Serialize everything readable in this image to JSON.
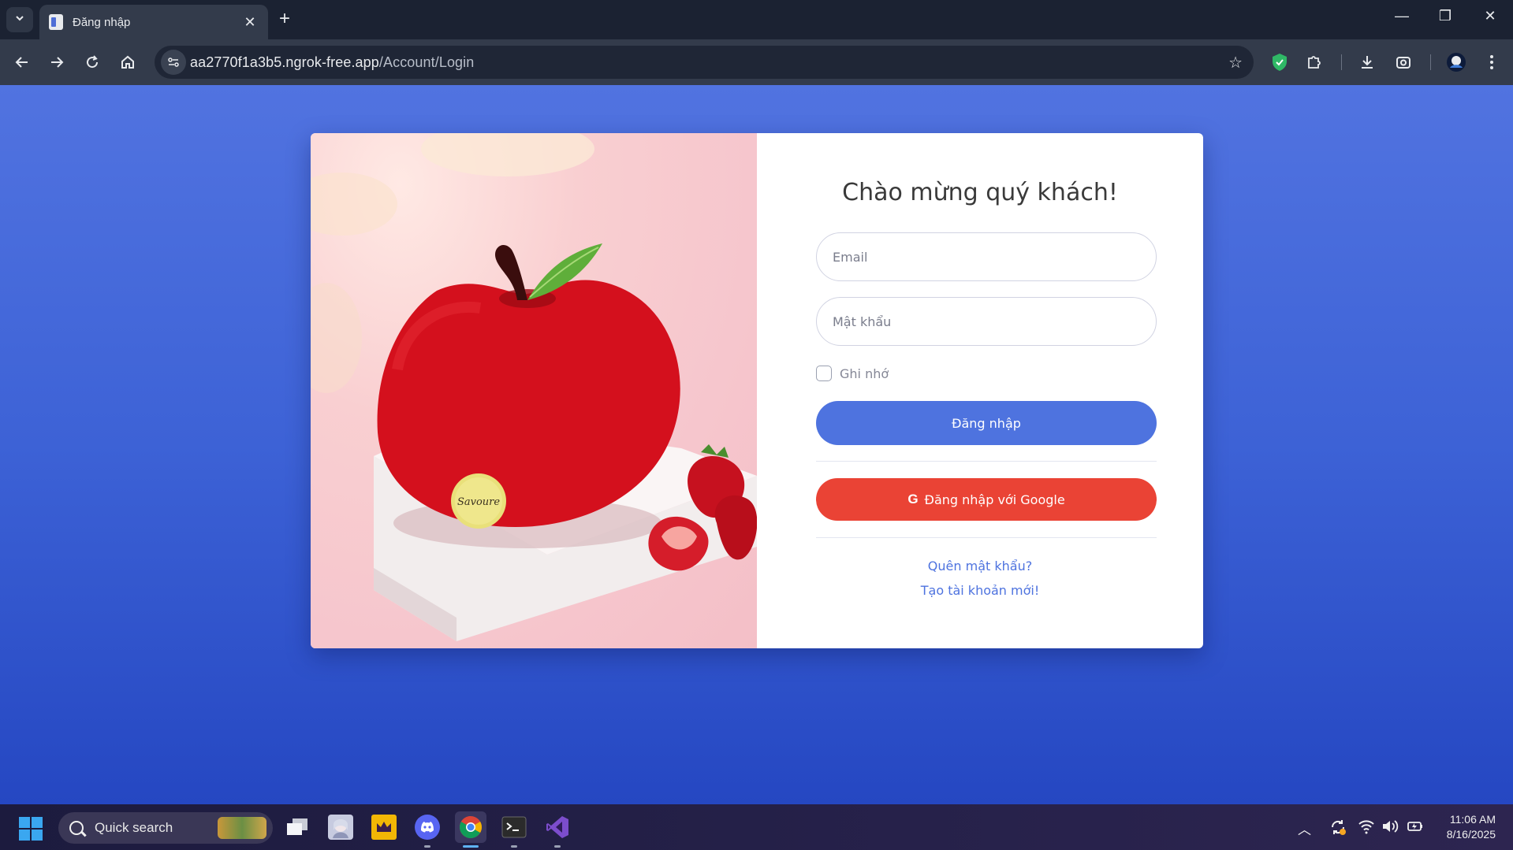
{
  "browser": {
    "tab_title": "Đăng nhập",
    "url_host": "aa2770f1a3b5.ngrok-free.app",
    "url_path": "/Account/Login"
  },
  "login": {
    "heading": "Chào mừng quý khách!",
    "email_placeholder": "Email",
    "password_placeholder": "Mật khẩu",
    "remember_label": "Ghi nhớ",
    "login_button": "Đăng nhập",
    "google_button": "Đăng nhập với Google",
    "forgot_password_link": "Quên mật khẩu?",
    "register_link": "Tạo tài khoản mới!",
    "photo_badge_text": "Savoure"
  },
  "taskbar": {
    "search_label": "Quick search",
    "time": "11:06 AM",
    "date": "8/16/2025"
  },
  "colors": {
    "page_background": "#3d62d6",
    "primary_button": "#4e73df",
    "google_button": "#ea4335",
    "link": "#4e73df"
  }
}
